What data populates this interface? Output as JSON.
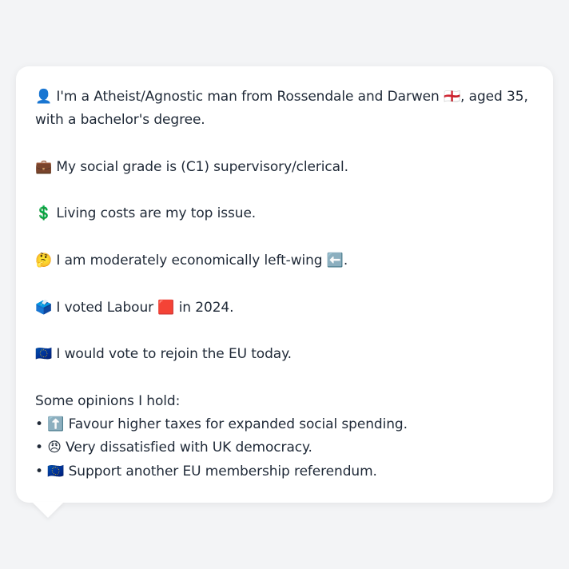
{
  "profile": {
    "intro": "👤 I'm a Atheist/Agnostic man from Rossendale and Darwen 🏴󠁧󠁢󠁥󠁮󠁧󠁿, aged 35, with a bachelor's degree.",
    "social_grade": "💼 My social grade is (C1) supervisory/clerical.",
    "top_issue": "💲 Living costs are my top issue.",
    "economic": "🤔 I am moderately economically left-wing ⬅️.",
    "vote": "🗳️ I voted Labour 🟥 in 2024.",
    "eu": "🇪🇺 I would vote to rejoin the EU today."
  },
  "opinions": {
    "heading": "Some opinions I hold:",
    "items": [
      "• ⬆️ Favour higher taxes for expanded social spending.",
      "• 😠 Very dissatisfied with UK democracy.",
      "• 🇪🇺 Support another EU membership referendum."
    ]
  }
}
